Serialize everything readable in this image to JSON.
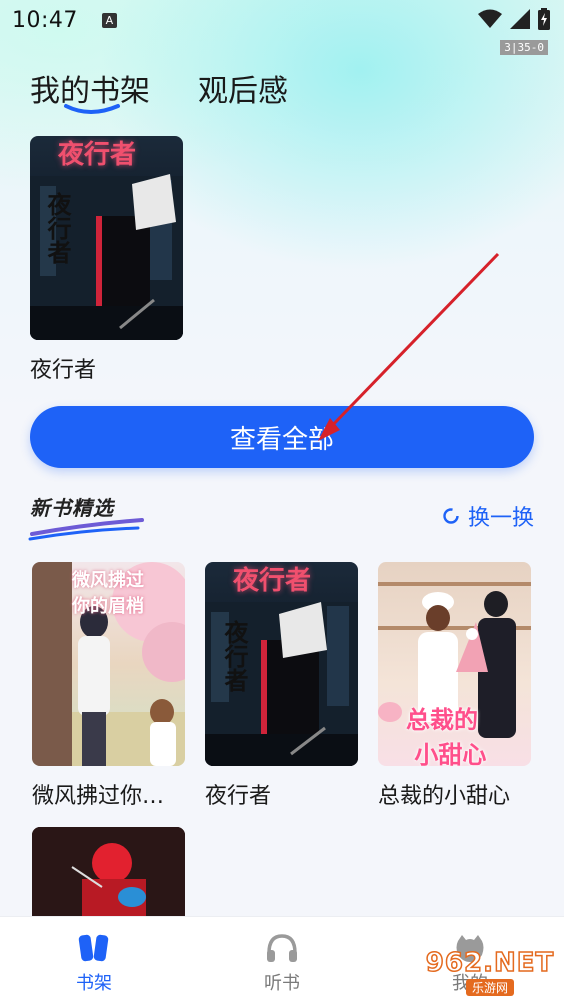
{
  "status": {
    "time": "10:47",
    "fps": "3|35-0"
  },
  "tabs": [
    {
      "label": "我的书架"
    },
    {
      "label": "观后感"
    }
  ],
  "shelf": {
    "books": [
      {
        "title": "夜行者"
      }
    ]
  },
  "view_all_label": "查看全部",
  "featured": {
    "title": "新书精选",
    "refresh_label": "换一换",
    "books": [
      {
        "title": "微风拂过你…"
      },
      {
        "title": "夜行者"
      },
      {
        "title": "总裁的小甜心"
      },
      {
        "title": ""
      }
    ]
  },
  "nav": [
    {
      "label": "书架"
    },
    {
      "label": "听书"
    },
    {
      "label": "我的"
    }
  ],
  "colors": {
    "accent": "#1e62f7",
    "arrow": "#d6212a"
  },
  "watermark": {
    "logo": "962.NET",
    "sub": "乐游网"
  }
}
